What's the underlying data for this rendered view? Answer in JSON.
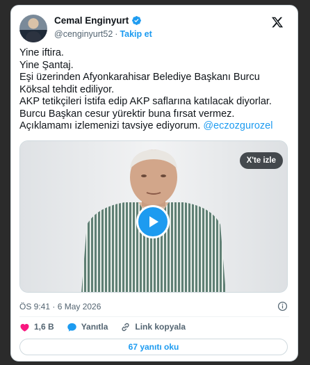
{
  "author": {
    "name": "Cemal Enginyurt",
    "handle": "@cenginyurt52",
    "separator": "·",
    "follow_label": "Takip et"
  },
  "tweet": {
    "lines": [
      "Yine iftira.",
      "Yine Şantaj.",
      "Eşi üzerinden Afyonkarahisar Belediye Başkanı Burcu",
      "Köksal tehdit ediliyor.",
      "AKP tetikçileri İstifa edip AKP saflarına katılacak diyorlar.",
      "Burcu Başkan cesur yürektir buna fırsat vermez."
    ],
    "last_line": "Açıklamamı izlemenizi tavsiye ediyorum.",
    "mention": "@eczozgurozel"
  },
  "media": {
    "watch_label": "X'te izle"
  },
  "timestamp": "ÖS 9:41 · 6 May 2026",
  "actions": {
    "likes": "1,6 B",
    "reply_label": "Yanıtla",
    "copy_link_label": "Link kopyala"
  },
  "replies_button": "67 yanıtı oku",
  "colors": {
    "accent": "#1d9bf0",
    "like": "#f91880",
    "text": "#0f1419",
    "secondary": "#536471"
  },
  "icons": [
    "verified-badge-icon",
    "x-logo-icon",
    "play-icon",
    "info-icon",
    "heart-icon",
    "reply-bubble-icon",
    "link-icon"
  ]
}
